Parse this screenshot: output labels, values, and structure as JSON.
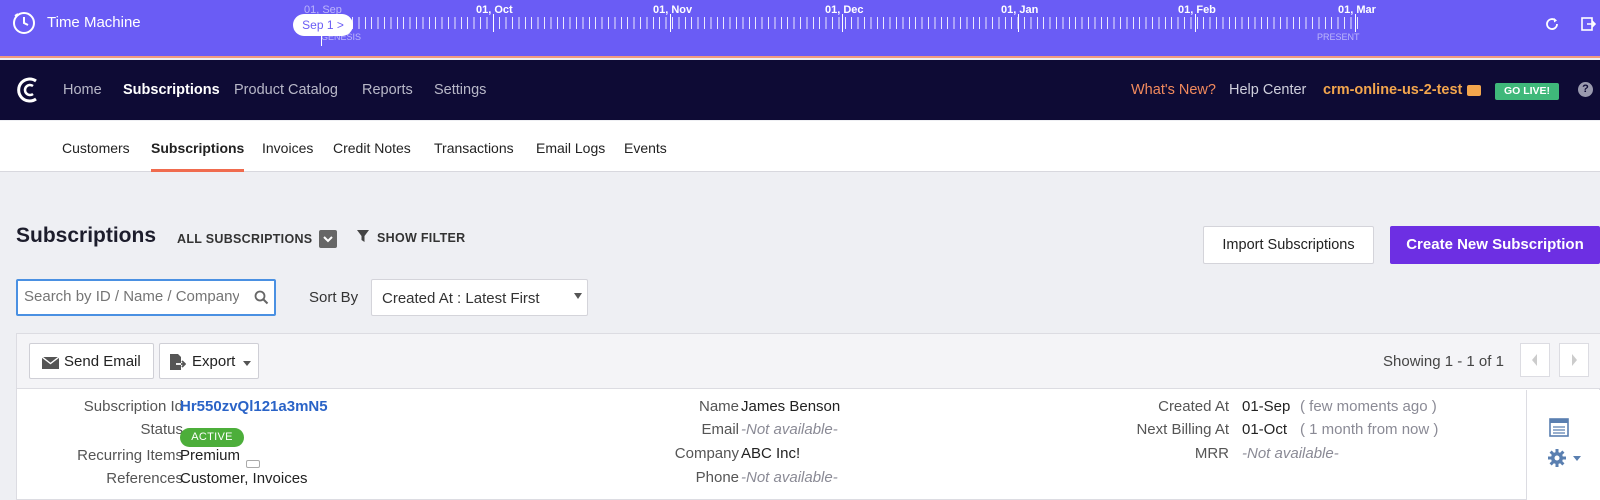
{
  "time_machine": {
    "title": "Time Machine",
    "current_label": "Sep 1 >",
    "start_month_label": "01, Sep",
    "genesis_label": "GENESIS",
    "present_label": "PRESENT",
    "months": [
      "01, Oct",
      "01, Nov",
      "01, Dec",
      "01, Jan",
      "01, Feb",
      "01, Mar"
    ]
  },
  "nav": {
    "items": [
      "Home",
      "Subscriptions",
      "Product Catalog",
      "Reports",
      "Settings"
    ],
    "active": "Subscriptions",
    "whats_new": "What's New?",
    "help_center": "Help Center",
    "site_name": "crm-online-us-2-test",
    "go_live": "GO LIVE!",
    "help_icon": "?"
  },
  "subnav": {
    "items": [
      "Customers",
      "Subscriptions",
      "Invoices",
      "Credit Notes",
      "Transactions",
      "Email Logs",
      "Events"
    ],
    "active": "Subscriptions"
  },
  "page": {
    "title": "Subscriptions",
    "view_selector": "ALL SUBSCRIPTIONS",
    "show_filter": "SHOW FILTER",
    "import_button": "Import Subscriptions",
    "create_button": "Create New Subscription",
    "search_placeholder": "Search by ID / Name / Company",
    "sort_by_label": "Sort By",
    "sort_value": "Created At : Latest First"
  },
  "toolbar": {
    "send_email": "Send Email",
    "export": "Export",
    "showing": "Showing 1 - 1 of 1"
  },
  "subscription": {
    "labels": {
      "id": "Subscription Id",
      "status": "Status",
      "recurring_items": "Recurring Items",
      "references": "References",
      "name": "Name",
      "email": "Email",
      "company": "Company",
      "phone": "Phone",
      "created_at": "Created At",
      "next_billing_at": "Next Billing At",
      "mrr": "MRR"
    },
    "id": "Hr550zvQl121a3mN5",
    "status": "ACTIVE",
    "recurring_items": "Premium",
    "references": "Customer, Invoices",
    "name": "James Benson",
    "email": "-Not available-",
    "company": "ABC Inc!",
    "phone": "-Not available-",
    "created_at": "01-Sep",
    "created_at_relative": "( few moments ago )",
    "next_billing_at": "01-Oct",
    "next_billing_relative": "( 1 month from now )",
    "mrr": "-Not available-"
  },
  "colors": {
    "time_machine_bg": "#6a5cf5",
    "nav_bg": "#0e0b35",
    "accent_orange": "#f06b4e",
    "primary_purple": "#6d2fe3",
    "link_blue": "#2a63c7",
    "status_green": "#4cae3a"
  },
  "icons": [
    "time-machine-logo-icon",
    "refresh-icon",
    "exit-icon",
    "brand-logo-icon",
    "mail-icon",
    "help-icon",
    "caret-down-icon",
    "filter-icon",
    "search-icon",
    "envelope-icon",
    "export-icon",
    "chevron-left-icon",
    "chevron-right-icon",
    "more-dots-icon",
    "list-icon",
    "gear-icon"
  ]
}
